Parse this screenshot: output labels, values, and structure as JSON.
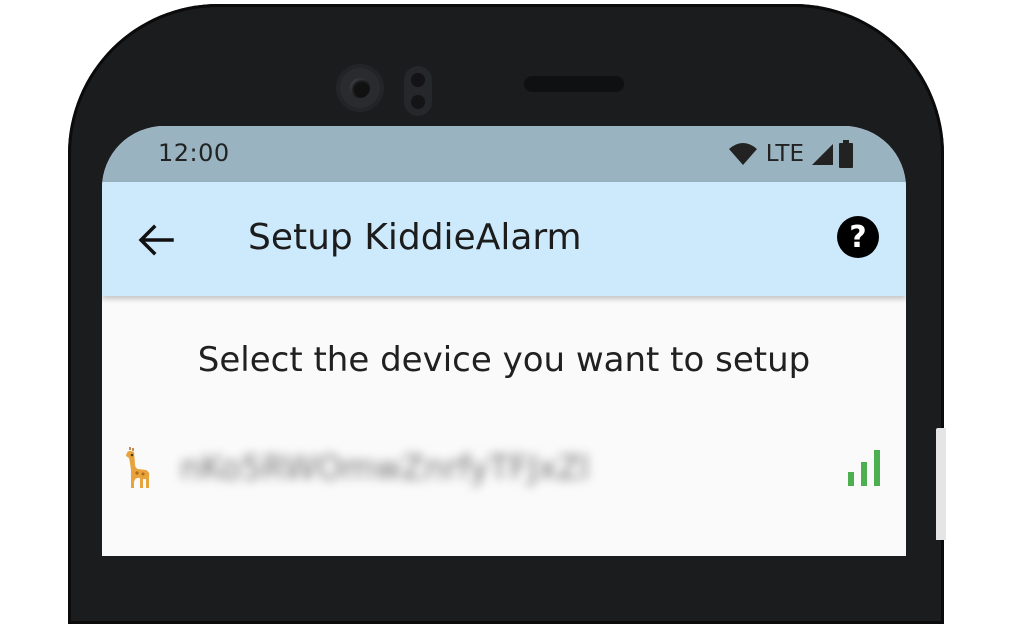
{
  "status_bar": {
    "time": "12:00",
    "network": "LTE",
    "icons": [
      "wifi-icon",
      "cell-signal-icon",
      "battery-icon"
    ]
  },
  "app_bar": {
    "title": "Setup KiddieAlarm",
    "background_color": "#cdeafd",
    "back_icon": "arrow-back-icon",
    "help_icon": "help-circle-icon"
  },
  "main": {
    "heading": "Select the device you want to setup",
    "devices": [
      {
        "name": "nKo5RWOmwZnrfyTFJxZl",
        "icon": "giraffe-icon",
        "signal": "strong",
        "signal_color": "#4caf50"
      }
    ]
  }
}
